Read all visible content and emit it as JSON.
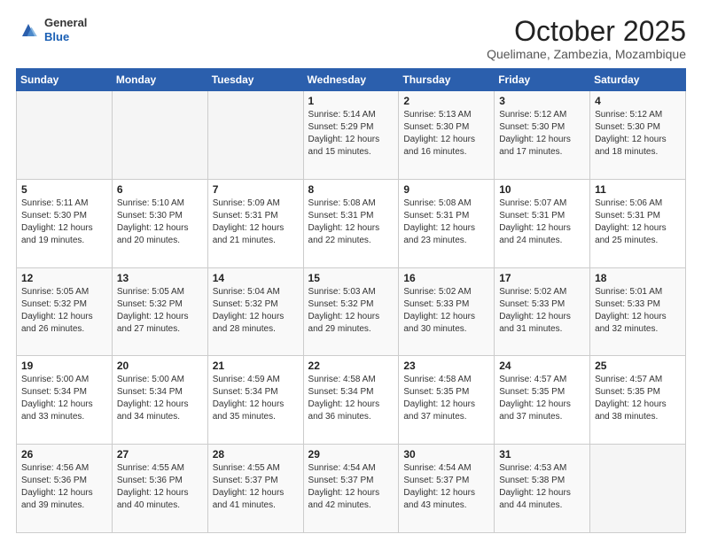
{
  "header": {
    "logo_general": "General",
    "logo_blue": "Blue",
    "month_year": "October 2025",
    "location": "Quelimane, Zambezia, Mozambique"
  },
  "days_of_week": [
    "Sunday",
    "Monday",
    "Tuesday",
    "Wednesday",
    "Thursday",
    "Friday",
    "Saturday"
  ],
  "weeks": [
    [
      {
        "day": "",
        "sunrise": "",
        "sunset": "",
        "daylight": ""
      },
      {
        "day": "",
        "sunrise": "",
        "sunset": "",
        "daylight": ""
      },
      {
        "day": "",
        "sunrise": "",
        "sunset": "",
        "daylight": ""
      },
      {
        "day": "1",
        "sunrise": "Sunrise: 5:14 AM",
        "sunset": "Sunset: 5:29 PM",
        "daylight": "Daylight: 12 hours and 15 minutes."
      },
      {
        "day": "2",
        "sunrise": "Sunrise: 5:13 AM",
        "sunset": "Sunset: 5:30 PM",
        "daylight": "Daylight: 12 hours and 16 minutes."
      },
      {
        "day": "3",
        "sunrise": "Sunrise: 5:12 AM",
        "sunset": "Sunset: 5:30 PM",
        "daylight": "Daylight: 12 hours and 17 minutes."
      },
      {
        "day": "4",
        "sunrise": "Sunrise: 5:12 AM",
        "sunset": "Sunset: 5:30 PM",
        "daylight": "Daylight: 12 hours and 18 minutes."
      }
    ],
    [
      {
        "day": "5",
        "sunrise": "Sunrise: 5:11 AM",
        "sunset": "Sunset: 5:30 PM",
        "daylight": "Daylight: 12 hours and 19 minutes."
      },
      {
        "day": "6",
        "sunrise": "Sunrise: 5:10 AM",
        "sunset": "Sunset: 5:30 PM",
        "daylight": "Daylight: 12 hours and 20 minutes."
      },
      {
        "day": "7",
        "sunrise": "Sunrise: 5:09 AM",
        "sunset": "Sunset: 5:31 PM",
        "daylight": "Daylight: 12 hours and 21 minutes."
      },
      {
        "day": "8",
        "sunrise": "Sunrise: 5:08 AM",
        "sunset": "Sunset: 5:31 PM",
        "daylight": "Daylight: 12 hours and 22 minutes."
      },
      {
        "day": "9",
        "sunrise": "Sunrise: 5:08 AM",
        "sunset": "Sunset: 5:31 PM",
        "daylight": "Daylight: 12 hours and 23 minutes."
      },
      {
        "day": "10",
        "sunrise": "Sunrise: 5:07 AM",
        "sunset": "Sunset: 5:31 PM",
        "daylight": "Daylight: 12 hours and 24 minutes."
      },
      {
        "day": "11",
        "sunrise": "Sunrise: 5:06 AM",
        "sunset": "Sunset: 5:31 PM",
        "daylight": "Daylight: 12 hours and 25 minutes."
      }
    ],
    [
      {
        "day": "12",
        "sunrise": "Sunrise: 5:05 AM",
        "sunset": "Sunset: 5:32 PM",
        "daylight": "Daylight: 12 hours and 26 minutes."
      },
      {
        "day": "13",
        "sunrise": "Sunrise: 5:05 AM",
        "sunset": "Sunset: 5:32 PM",
        "daylight": "Daylight: 12 hours and 27 minutes."
      },
      {
        "day": "14",
        "sunrise": "Sunrise: 5:04 AM",
        "sunset": "Sunset: 5:32 PM",
        "daylight": "Daylight: 12 hours and 28 minutes."
      },
      {
        "day": "15",
        "sunrise": "Sunrise: 5:03 AM",
        "sunset": "Sunset: 5:32 PM",
        "daylight": "Daylight: 12 hours and 29 minutes."
      },
      {
        "day": "16",
        "sunrise": "Sunrise: 5:02 AM",
        "sunset": "Sunset: 5:33 PM",
        "daylight": "Daylight: 12 hours and 30 minutes."
      },
      {
        "day": "17",
        "sunrise": "Sunrise: 5:02 AM",
        "sunset": "Sunset: 5:33 PM",
        "daylight": "Daylight: 12 hours and 31 minutes."
      },
      {
        "day": "18",
        "sunrise": "Sunrise: 5:01 AM",
        "sunset": "Sunset: 5:33 PM",
        "daylight": "Daylight: 12 hours and 32 minutes."
      }
    ],
    [
      {
        "day": "19",
        "sunrise": "Sunrise: 5:00 AM",
        "sunset": "Sunset: 5:34 PM",
        "daylight": "Daylight: 12 hours and 33 minutes."
      },
      {
        "day": "20",
        "sunrise": "Sunrise: 5:00 AM",
        "sunset": "Sunset: 5:34 PM",
        "daylight": "Daylight: 12 hours and 34 minutes."
      },
      {
        "day": "21",
        "sunrise": "Sunrise: 4:59 AM",
        "sunset": "Sunset: 5:34 PM",
        "daylight": "Daylight: 12 hours and 35 minutes."
      },
      {
        "day": "22",
        "sunrise": "Sunrise: 4:58 AM",
        "sunset": "Sunset: 5:34 PM",
        "daylight": "Daylight: 12 hours and 36 minutes."
      },
      {
        "day": "23",
        "sunrise": "Sunrise: 4:58 AM",
        "sunset": "Sunset: 5:35 PM",
        "daylight": "Daylight: 12 hours and 37 minutes."
      },
      {
        "day": "24",
        "sunrise": "Sunrise: 4:57 AM",
        "sunset": "Sunset: 5:35 PM",
        "daylight": "Daylight: 12 hours and 37 minutes."
      },
      {
        "day": "25",
        "sunrise": "Sunrise: 4:57 AM",
        "sunset": "Sunset: 5:35 PM",
        "daylight": "Daylight: 12 hours and 38 minutes."
      }
    ],
    [
      {
        "day": "26",
        "sunrise": "Sunrise: 4:56 AM",
        "sunset": "Sunset: 5:36 PM",
        "daylight": "Daylight: 12 hours and 39 minutes."
      },
      {
        "day": "27",
        "sunrise": "Sunrise: 4:55 AM",
        "sunset": "Sunset: 5:36 PM",
        "daylight": "Daylight: 12 hours and 40 minutes."
      },
      {
        "day": "28",
        "sunrise": "Sunrise: 4:55 AM",
        "sunset": "Sunset: 5:37 PM",
        "daylight": "Daylight: 12 hours and 41 minutes."
      },
      {
        "day": "29",
        "sunrise": "Sunrise: 4:54 AM",
        "sunset": "Sunset: 5:37 PM",
        "daylight": "Daylight: 12 hours and 42 minutes."
      },
      {
        "day": "30",
        "sunrise": "Sunrise: 4:54 AM",
        "sunset": "Sunset: 5:37 PM",
        "daylight": "Daylight: 12 hours and 43 minutes."
      },
      {
        "day": "31",
        "sunrise": "Sunrise: 4:53 AM",
        "sunset": "Sunset: 5:38 PM",
        "daylight": "Daylight: 12 hours and 44 minutes."
      },
      {
        "day": "",
        "sunrise": "",
        "sunset": "",
        "daylight": ""
      }
    ]
  ]
}
